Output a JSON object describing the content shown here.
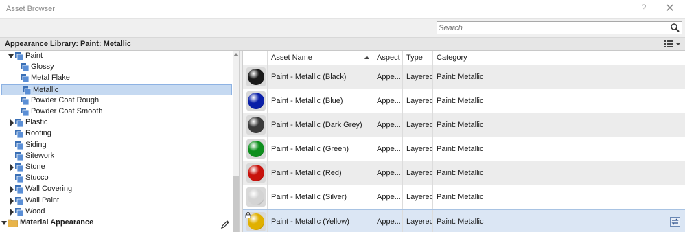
{
  "window": {
    "title": "Asset Browser",
    "help_label": "?",
    "close_label": "✕"
  },
  "search": {
    "placeholder": "Search",
    "value": ""
  },
  "library_header": {
    "title": "Appearance Library: Paint: Metallic",
    "view_icon": "list-view-icon"
  },
  "tree": {
    "items": [
      {
        "label": "Paint",
        "expanded": true,
        "icon": "library-folder-icon"
      },
      {
        "label": "Glossy",
        "icon": "library-folder-icon"
      },
      {
        "label": "Metal Flake",
        "icon": "library-folder-icon"
      },
      {
        "label": "Metallic",
        "icon": "library-folder-icon",
        "selected": true
      },
      {
        "label": "Powder Coat Rough",
        "icon": "library-folder-icon"
      },
      {
        "label": "Powder Coat Smooth",
        "icon": "library-folder-icon"
      },
      {
        "label": "Plastic",
        "expanded": false,
        "icon": "library-folder-icon"
      },
      {
        "label": "Roofing",
        "icon": "library-folder-icon"
      },
      {
        "label": "Siding",
        "icon": "library-folder-icon"
      },
      {
        "label": "Sitework",
        "icon": "library-folder-icon"
      },
      {
        "label": "Stone",
        "expanded": false,
        "icon": "library-folder-icon"
      },
      {
        "label": "Stucco",
        "icon": "library-folder-icon"
      },
      {
        "label": "Wall Covering",
        "expanded": false,
        "icon": "library-folder-icon"
      },
      {
        "label": "Wall Paint",
        "expanded": false,
        "icon": "library-folder-icon"
      },
      {
        "label": "Wood",
        "expanded": false,
        "icon": "library-folder-icon"
      },
      {
        "label": "Material Appearance",
        "expanded": true,
        "icon": "folder-icon"
      }
    ]
  },
  "grid": {
    "columns": [
      "Asset Name",
      "Aspect",
      "Type",
      "Category"
    ],
    "sorted_column": "Asset Name",
    "sort_direction": "ascending",
    "rows": [
      {
        "name": "Paint - Metallic (Black)",
        "aspect": "Appe...",
        "type": "Layered",
        "category": "Paint: Metallic",
        "color": "#1a1a1a"
      },
      {
        "name": "Paint - Metallic (Blue)",
        "aspect": "Appe...",
        "type": "Layered",
        "category": "Paint: Metallic",
        "color": "#0a1fa8"
      },
      {
        "name": "Paint - Metallic (Dark Grey)",
        "aspect": "Appe...",
        "type": "Layered",
        "category": "Paint: Metallic",
        "color": "#3a3a3a"
      },
      {
        "name": "Paint - Metallic (Green)",
        "aspect": "Appe...",
        "type": "Layered",
        "category": "Paint: Metallic",
        "color": "#0e8f1e"
      },
      {
        "name": "Paint - Metallic (Red)",
        "aspect": "Appe...",
        "type": "Layered",
        "category": "Paint: Metallic",
        "color": "#c8120c"
      },
      {
        "name": "Paint - Metallic (Silver)",
        "aspect": "Appe...",
        "type": "Layered",
        "category": "Paint: Metallic",
        "color": "#d4d4d4"
      },
      {
        "name": "Paint - Metallic (Yellow)",
        "aspect": "Appe...",
        "type": "Layered",
        "category": "Paint: Metallic",
        "color": "#e0b000",
        "selected": true,
        "locked": true
      }
    ]
  }
}
